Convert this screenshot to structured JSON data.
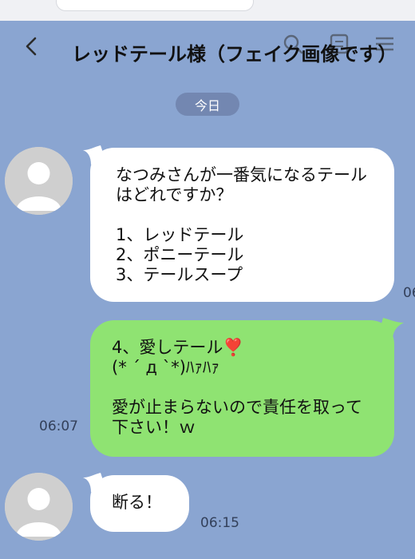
{
  "header": {
    "title": "レッドテール様（フェイク画像です）"
  },
  "date_chip": "今日",
  "messages": [
    {
      "side": "incoming",
      "text": "なつみさんが一番気になるテールはどれですか？\n\n1、レッドテール\n2、ポニーテール\n3、テールスープ",
      "time": "06"
    },
    {
      "side": "outgoing",
      "text": "4、愛しテール❣️\n(* ´ д `*)ﾊｧﾊｧ\n\n愛が止まらないので責任を取って下さい！ｗ",
      "time": "06:07"
    },
    {
      "side": "incoming",
      "text": "断る！",
      "time": "06:15"
    }
  ],
  "colors": {
    "background": "#8aa5d1",
    "incoming_bubble": "#ffffff",
    "outgoing_bubble": "#8fe372",
    "date_chip": "#7387b1"
  },
  "icons": [
    "back-icon",
    "search-icon",
    "call-icon",
    "menu-icon",
    "avatar-icon"
  ]
}
